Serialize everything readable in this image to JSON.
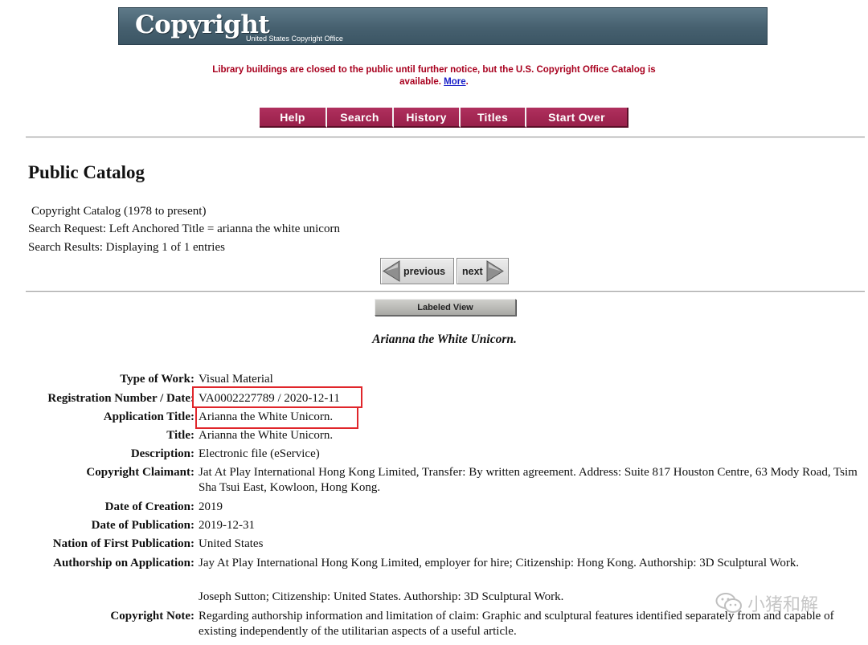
{
  "banner": {
    "logo_text": "Copyright",
    "subtitle": "United States Copyright Office"
  },
  "notice": {
    "text": "Library buildings are closed to the public until further notice, but the U.S. Copyright Office Catalog is available.",
    "link": "More",
    "trail": "."
  },
  "nav": {
    "help": "Help",
    "search": "Search",
    "history": "History",
    "titles": "Titles",
    "start_over": "Start Over"
  },
  "page": {
    "title": "Public Catalog",
    "catalog": "Copyright Catalog (1978 to present)",
    "search_request": "Search Request: Left Anchored Title = arianna the white unicorn",
    "search_results": "Search Results: Displaying 1 of 1 entries"
  },
  "pager": {
    "previous": "previous",
    "next": "next",
    "labeled_view": "Labeled View"
  },
  "record": {
    "heading": "Arianna the White Unicorn.",
    "fields": [
      {
        "label": "Type of Work:",
        "value": "Visual Material"
      },
      {
        "label": "Registration Number / Date:",
        "value": "VA0002227789 / 2020-12-11"
      },
      {
        "label": "Application Title:",
        "value": "Arianna the White Unicorn."
      },
      {
        "label": "Title:",
        "value": "Arianna the White Unicorn."
      },
      {
        "label": "Description:",
        "value": "Electronic file (eService)"
      },
      {
        "label": "Copyright Claimant:",
        "value": "Jat At Play International Hong Kong Limited, Transfer: By written agreement. Address: Suite 817 Houston Centre, 63 Mody Road, Tsim Sha Tsui East, Kowloon, Hong Kong."
      },
      {
        "label": "Date of Creation:",
        "value": "2019"
      },
      {
        "label": "Date of Publication:",
        "value": "2019-12-31"
      },
      {
        "label": "Nation of First Publication:",
        "value": "United States"
      },
      {
        "label": "Authorship on Application:",
        "value": "Jay At Play International Hong Kong Limited, employer for hire; Citizenship: Hong Kong. Authorship: 3D Sculptural Work."
      },
      {
        "label": "",
        "value": "Joseph Sutton; Citizenship: United States. Authorship: 3D Sculptural Work."
      },
      {
        "label": "Copyright Note:",
        "value": "Regarding authorship information and limitation of claim: Graphic and sculptural features identified separately from and capable of existing independently of the utilitarian aspects of a useful article."
      }
    ]
  },
  "watermark": {
    "text": "小猪和解",
    "icon": "wechat-icon"
  },
  "colors": {
    "notice_red": "#a8001e",
    "nav_maroon": "#a52a55",
    "highlight_red": "#e0262b",
    "link_blue": "#1a20c8"
  }
}
